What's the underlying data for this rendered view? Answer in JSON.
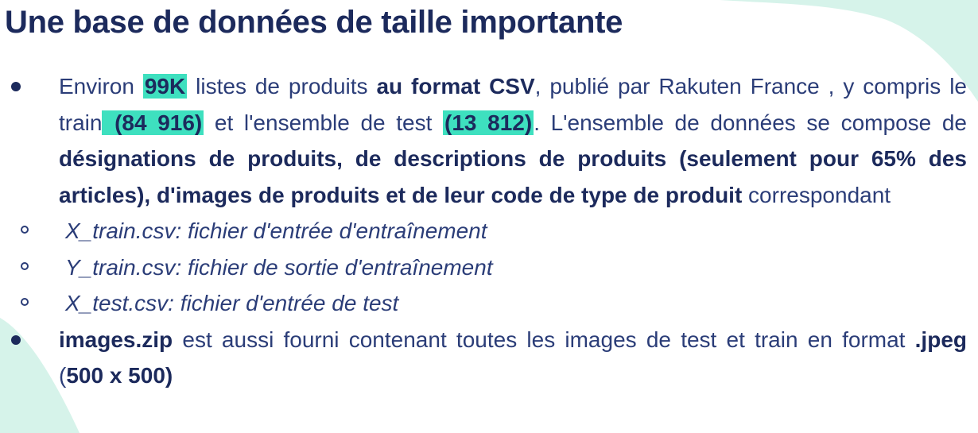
{
  "title": "Une base de données de taille importante",
  "bullet1": {
    "t1": "Environ ",
    "count": "99K",
    "t2": " listes de produits ",
    "format": "au format CSV",
    "t3": ", publié par Rakuten France , y compris le train",
    "train_count": " (84 916)",
    "t4": " et l'ensemble de test ",
    "test_count": "(13 812)",
    "t5": ". L'ensemble de données se compose de ",
    "components": "désignations de produits, de descriptions de produits (seulement pour 65% des articles), d'images de produits et de leur code de type de produit",
    "t6": " correspondant"
  },
  "files": [
    "X_train.csv: fichier d'entrée d'entraînement",
    "Y_train.csv: fichier de sortie d'entraînement",
    "X_test.csv: fichier d'entrée de test"
  ],
  "bullet2": {
    "archive": "images.zip",
    "t1": " est aussi fourni contenant toutes les images de test et train en format ",
    "ext": ".jpeg",
    "t2": " (",
    "size": "500 x 500)"
  },
  "colors": {
    "text": "#2b3d78",
    "title": "#1c2a5c",
    "highlight": "#3ee0bf",
    "decoration": "#d6f3ea"
  }
}
